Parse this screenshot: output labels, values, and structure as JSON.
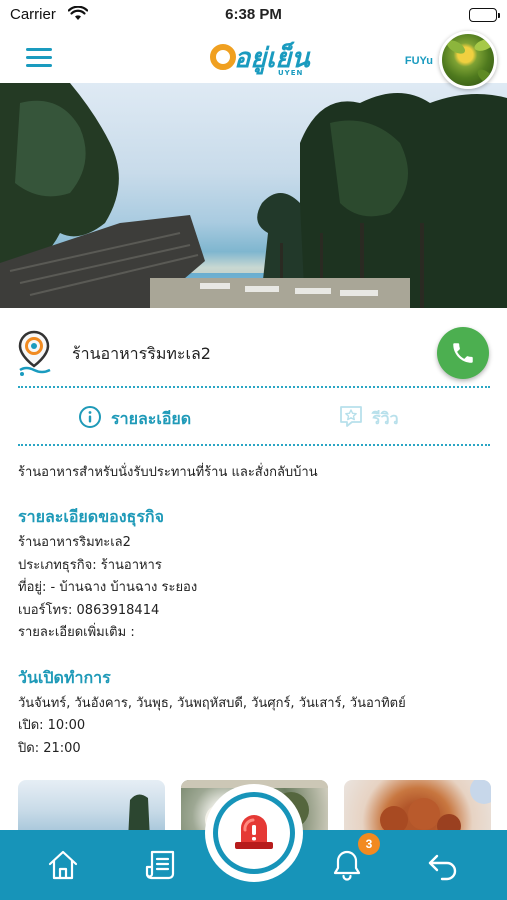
{
  "status_bar": {
    "carrier": "Carrier",
    "time": "6:38 PM"
  },
  "header": {
    "logo_text": "อยู่เย็น",
    "logo_subtext": "UYEN",
    "username": "FUYu"
  },
  "business": {
    "name": "ร้านอาหารริมทะเล2"
  },
  "tabs": [
    {
      "label": "รายละเอียด",
      "active": true
    },
    {
      "label": "รีวิว",
      "active": false
    }
  ],
  "content": {
    "description": "ร้านอาหารสำหรับนั่งรับประทานที่ร้าน และสั่งกลับบ้าน",
    "details_title": "รายละเอียดของธุรกิจ",
    "details_lines": [
      "ร้านอาหารริมทะเล2",
      "ประเภทธุรกิจ: ร้านอาหาร",
      "ที่อยู่: - บ้านฉาง บ้านฉาง ระยอง",
      "เบอร์โทร: 0863918414",
      "รายละเอียดเพิ่มเติม :"
    ],
    "hours_title": "วันเปิดทำการ",
    "hours_lines": [
      "วันจันทร์, วันอังคาร, วันพุธ, วันพฤหัสบดี, วันศุกร์, วันเสาร์, วันอาทิตย์",
      "เปิด: 10:00",
      "ปิด: 21:00"
    ]
  },
  "bottom_nav": {
    "notification_count": "3",
    "items": [
      "home-icon",
      "list-icon",
      "sos-siren-icon",
      "bell-icon",
      "back-arrow-icon"
    ]
  },
  "colors": {
    "primary": "#1794b9",
    "accent": "#f0a020",
    "call": "#4caf50",
    "badge": "#f28a20"
  }
}
